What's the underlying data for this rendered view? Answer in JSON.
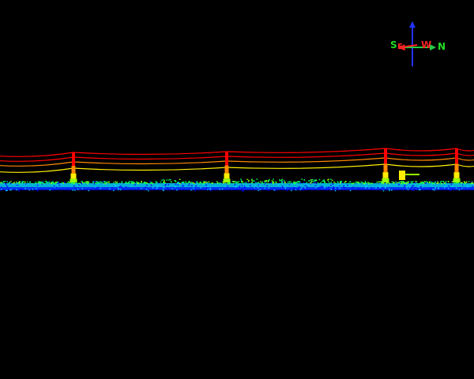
{
  "viewer": {
    "background_color": "#000000"
  },
  "compass": {
    "labels": {
      "south": "S",
      "east": "E",
      "west": "W",
      "north": "N"
    },
    "colors": {
      "south": "#22dd22",
      "east": "#ff2222",
      "west": "#ff2222",
      "north": "#22dd22",
      "vertical_axis": "#2233ff",
      "horizontal_axis": "#22cc44",
      "arrow": "#ff2222"
    }
  },
  "point_cloud": {
    "color_ramp": [
      "#0000ff",
      "#00ccff",
      "#00ff66",
      "#99ff00",
      "#ffee00",
      "#ff8800",
      "#ff0000"
    ],
    "tower_icons": [
      "transmission-tower-icon",
      "transmission-tower-icon",
      "transmission-tower-icon",
      "transmission-tower-icon"
    ]
  }
}
